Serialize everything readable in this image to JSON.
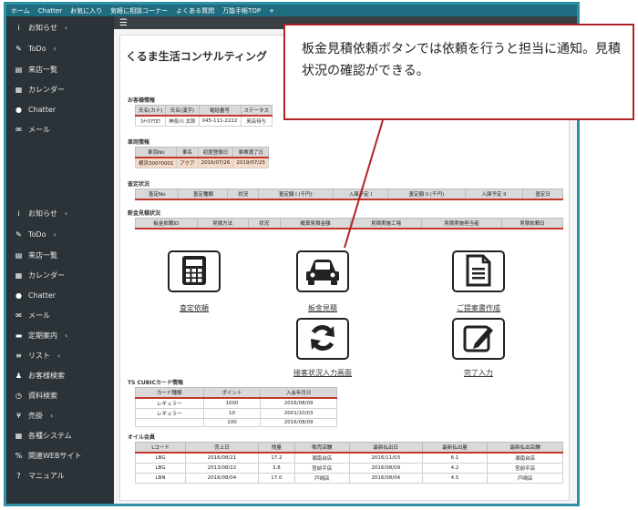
{
  "topnav": {
    "items": [
      "ホーム",
      "Chatter",
      "お気に入り",
      "気軽に相談コーナー",
      "よくある質問",
      "万能手帳TOP",
      "+"
    ]
  },
  "sidebar": {
    "group1": [
      {
        "icon": "info-icon",
        "glyph": "i",
        "label": "お知らせ",
        "chevron": "‹"
      },
      {
        "icon": "edit-icon",
        "glyph": "✎",
        "label": "ToDo",
        "chevron": "‹"
      },
      {
        "icon": "store-icon",
        "glyph": "▤",
        "label": "来店一覧",
        "chevron": ""
      },
      {
        "icon": "calendar-icon",
        "glyph": "▦",
        "label": "カレンダー",
        "chevron": ""
      },
      {
        "icon": "chat-icon",
        "glyph": "●",
        "label": "Chatter",
        "chevron": ""
      },
      {
        "icon": "mail-icon",
        "glyph": "✉",
        "label": "メール",
        "chevron": ""
      }
    ],
    "group2": [
      {
        "icon": "info-icon",
        "glyph": "i",
        "label": "お知らせ",
        "chevron": "‹"
      },
      {
        "icon": "edit-icon",
        "glyph": "✎",
        "label": "ToDo",
        "chevron": "‹"
      },
      {
        "icon": "store-icon",
        "glyph": "▤",
        "label": "来店一覧",
        "chevron": ""
      },
      {
        "icon": "calendar-icon",
        "glyph": "▦",
        "label": "カレンダー",
        "chevron": ""
      },
      {
        "icon": "chat-icon",
        "glyph": "●",
        "label": "Chatter",
        "chevron": ""
      },
      {
        "icon": "mail-icon",
        "glyph": "✉",
        "label": "メール",
        "chevron": ""
      },
      {
        "icon": "car-icon",
        "glyph": "▬",
        "label": "定期案内",
        "chevron": "‹"
      },
      {
        "icon": "list-icon",
        "glyph": "≡",
        "label": "リスト",
        "chevron": "‹"
      },
      {
        "icon": "users-icon",
        "glyph": "♟",
        "label": "お客様検索",
        "chevron": ""
      },
      {
        "icon": "clock-icon",
        "glyph": "◷",
        "label": "資料検索",
        "chevron": ""
      },
      {
        "icon": "yen-icon",
        "glyph": "¥",
        "label": "売掛",
        "chevron": "‹"
      },
      {
        "icon": "system-icon",
        "glyph": "▦",
        "label": "各種システム",
        "chevron": ""
      },
      {
        "icon": "link-icon",
        "glyph": "%",
        "label": "関連WEBサイト",
        "chevron": ""
      },
      {
        "icon": "help-icon",
        "glyph": "?",
        "label": "マニュアル",
        "chevron": ""
      }
    ]
  },
  "main": {
    "company": "くるま生活コンサルティング",
    "customer": {
      "label": "お客様情報",
      "headers": [
        "氏名(カナ)",
        "氏名(漢字)",
        "電話番号",
        "ステータス"
      ],
      "row": [
        "ｶﾅｲｵｱｸﾛｳ",
        "神奈川 太郎",
        "045-111-2222",
        "来店待ち"
      ]
    },
    "vehicle": {
      "label": "車両情報",
      "headers": [
        "車両No",
        "車名",
        "初度登録日",
        "車検満了日"
      ],
      "row": [
        "横浜300?0001",
        "アクア",
        "2016/07/26",
        "2019/07/25"
      ]
    },
    "assessment": {
      "label": "査定状況",
      "headers": [
        "査定No",
        "査定種類",
        "状況",
        "査定額 I (千円)",
        "入庫予定 I",
        "査定額 II (千円)",
        "入庫予定 II",
        "査定日"
      ]
    },
    "new_estimate": {
      "label": "新金見積状況",
      "headers": [
        "板金依頼ID",
        "見積方法",
        "状況",
        "概算見積金額",
        "見積実施工場",
        "見積実施担当者",
        "見積依頼日"
      ]
    },
    "actions": [
      {
        "name": "assessment-request",
        "icon": "calculator-icon",
        "label": "査定依頼"
      },
      {
        "name": "sheet-metal-estimate",
        "icon": "car-icon",
        "label": "板金見積"
      },
      {
        "name": "proposal-create",
        "icon": "document-icon",
        "label": "ご提案書作成"
      },
      {
        "name": "service-status-input",
        "icon": "refresh-icon",
        "label": "接客状況入力画面"
      },
      {
        "name": "complete-input",
        "icon": "pencil-icon",
        "label": "完了入力"
      }
    ],
    "ts_cubic": {
      "label": "TS CUBICカード情報",
      "headers": [
        "カード種類",
        "ポイント",
        "入会年月日"
      ],
      "rows": [
        [
          "レギュラー",
          "1000",
          "2016/08/09"
        ],
        [
          "レギュラー",
          "10",
          "2001/10/03"
        ],
        [
          "",
          "100",
          "2016/08/09"
        ]
      ]
    },
    "oil": {
      "label": "オイル会員",
      "headers": [
        "Lコード",
        "売上日",
        "残量",
        "販売店舗",
        "最新払出日",
        "最新払出量",
        "最新払出店舗"
      ],
      "rows": [
        [
          "LBG",
          "2016/08/21",
          "17.2",
          "湘南台店",
          "2016/11/03",
          "6.1",
          "湘南台店"
        ],
        [
          "LBG",
          "2013/08/22",
          "3.8",
          "宮前平店",
          "2016/08/09",
          "4.2",
          "宮前平店"
        ],
        [
          "LBN",
          "2016/08/04",
          "17.0",
          "戸崎店",
          "2016/08/04",
          "4.5",
          "戸崎店"
        ]
      ]
    }
  },
  "callout": {
    "text": "板金見積依頼ボタンでは依頼を行うと担当に通知。見積状況の確認ができる。"
  },
  "colors": {
    "sidebar_bg": "#2c3338",
    "topnav_bg": "#1f6d80",
    "accent_red": "#c0392b",
    "callout_border": "#b22222",
    "highlight_row": "#f7d9c7"
  }
}
